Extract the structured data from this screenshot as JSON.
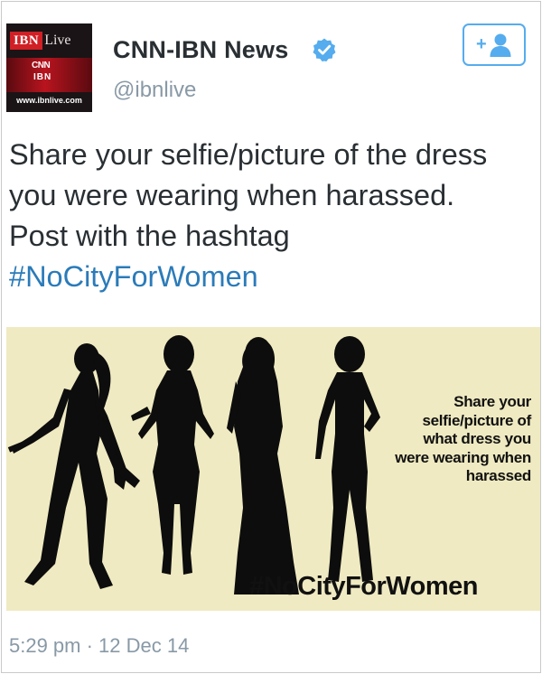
{
  "author": {
    "display_name": "CNN-IBN News",
    "handle": "@ibnlive",
    "verified": true,
    "avatar": {
      "brand_ibn": "IBN",
      "brand_live": "Live",
      "logo_cnn": "CNN",
      "logo_ibn": "IBN",
      "url": "www.ibnlive.com"
    }
  },
  "follow_button": {
    "icon": "follow-user-icon",
    "plus": "+"
  },
  "tweet": {
    "lines": [
      "Share your selfie/picture of the dress",
      "you were wearing when harassed.",
      "Post with the hashtag"
    ],
    "hashtag": "#NoCityForWomen"
  },
  "media": {
    "caption_lines": [
      "Share your",
      "selfie/picture of",
      "what dress you",
      "were wearing when",
      "harassed"
    ],
    "hashtag": "#NoCityForWomen"
  },
  "timestamp": "5:29 pm · 12 Dec 14",
  "colors": {
    "link": "#2b7bb9",
    "verified": "#55acee",
    "muted": "#8899a6",
    "media_background": "#efeac1",
    "text": "#292f33"
  }
}
